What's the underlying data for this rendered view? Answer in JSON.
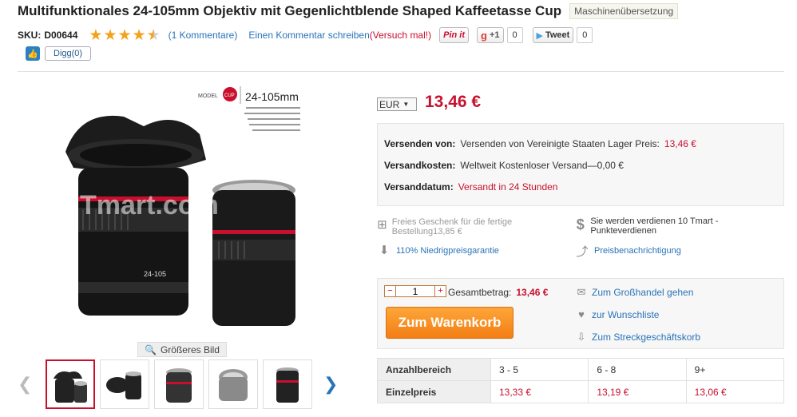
{
  "product": {
    "title": "Multifunktionales 24-105mm Objektiv mit Gegenlichtblende Shaped Kaffeetasse Cup",
    "mt_badge": "Maschinenübersetzung",
    "sku_label": "SKU:",
    "sku": "D00644",
    "rating_stars": 4.5
  },
  "social": {
    "comments": "(1 Kommentare)",
    "write_comment": "Einen Kommentar schreiben",
    "try_it": "(Versuch mal!)",
    "pinit": "Pin it",
    "gplus": "+1",
    "gplus_count": "0",
    "tweet": "Tweet",
    "tweet_count": "0",
    "digg": "Digg(0)"
  },
  "gallery": {
    "bigger_image": "Größeres Bild",
    "image_label": "24-105mm",
    "model_label": "MODEL",
    "cup_label": "CUP",
    "watermark": "Tmart.com"
  },
  "pricing": {
    "currency": "EUR",
    "price": "13,46 €"
  },
  "shipping": {
    "from_label": "Versenden von:",
    "from_value": "Versenden von Vereinigte Staaten Lager Preis:",
    "from_price": "13,46 €",
    "cost_label": "Versandkosten:",
    "cost_value": "Weltweit Kostenloser Versand—0,00 €",
    "date_label": "Versanddatum:",
    "date_value": "Versandt in 24 Stunden"
  },
  "features": {
    "gift": "Freies Geschenk für die fertige Bestellung13,85 €",
    "points": "Sie werden verdienen 10 Tmart -Punkteverdienen",
    "guarantee": "110% Niedrigpreisgarantie",
    "price_alert": "Preisbenachrichtigung"
  },
  "buy": {
    "qty_minus": "−",
    "qty_value": "1",
    "qty_plus": "+",
    "total_label": "Gesamtbetrag:",
    "total_value": "13,46 €",
    "cart_button": "Zum Warenkorb",
    "wholesale": "Zum Großhandel gehen",
    "wishlist": "zur Wunschliste",
    "dropship": "Zum Streckgeschäftskorb"
  },
  "tiers": {
    "range_label": "Anzahlbereich",
    "price_label": "Einzelpreis",
    "ranges": [
      "3 - 5",
      "6 - 8",
      "9+"
    ],
    "prices": [
      "13,33 €",
      "13,19 €",
      "13,06 €"
    ]
  },
  "colors": {
    "accent_red": "#c8102e",
    "link_blue": "#2a73b8",
    "cart_orange": "#f37e14"
  }
}
